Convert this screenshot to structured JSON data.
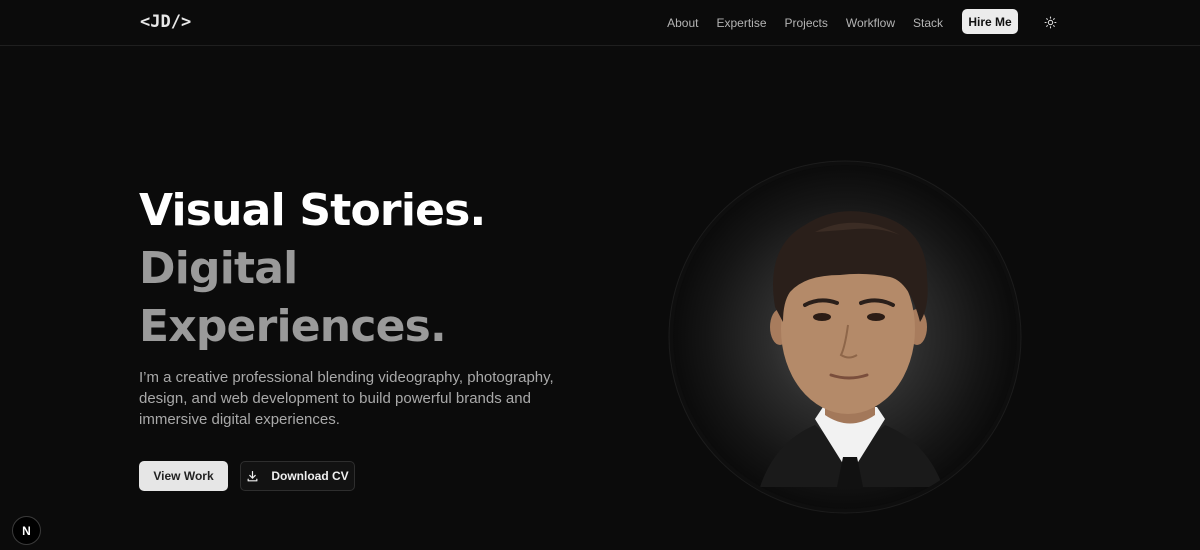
{
  "header": {
    "logo": "<JD/>",
    "nav": [
      "About",
      "Expertise",
      "Projects",
      "Workflow",
      "Stack"
    ],
    "cta_label": "Hire Me",
    "theme_icon": "sun-icon"
  },
  "hero": {
    "title_line_1": "Visual Stories.",
    "title_line_2": "Digital",
    "title_line_3": "Experiences.",
    "description": "I’m a creative professional blending videography, photography, design, and web development to build powerful brands and immersive digital experiences.",
    "primary_button": "View Work",
    "secondary_button": "Download CV",
    "secondary_icon": "download-icon",
    "portrait_icon": "profile-portrait"
  },
  "dev_badge": {
    "label": "N"
  },
  "colors": {
    "background": "#0b0b0b",
    "title_primary": "#ffffff",
    "title_muted": "#9a9a9a",
    "body_text": "#a9a9a9",
    "button_light": "#e6e6e6"
  }
}
